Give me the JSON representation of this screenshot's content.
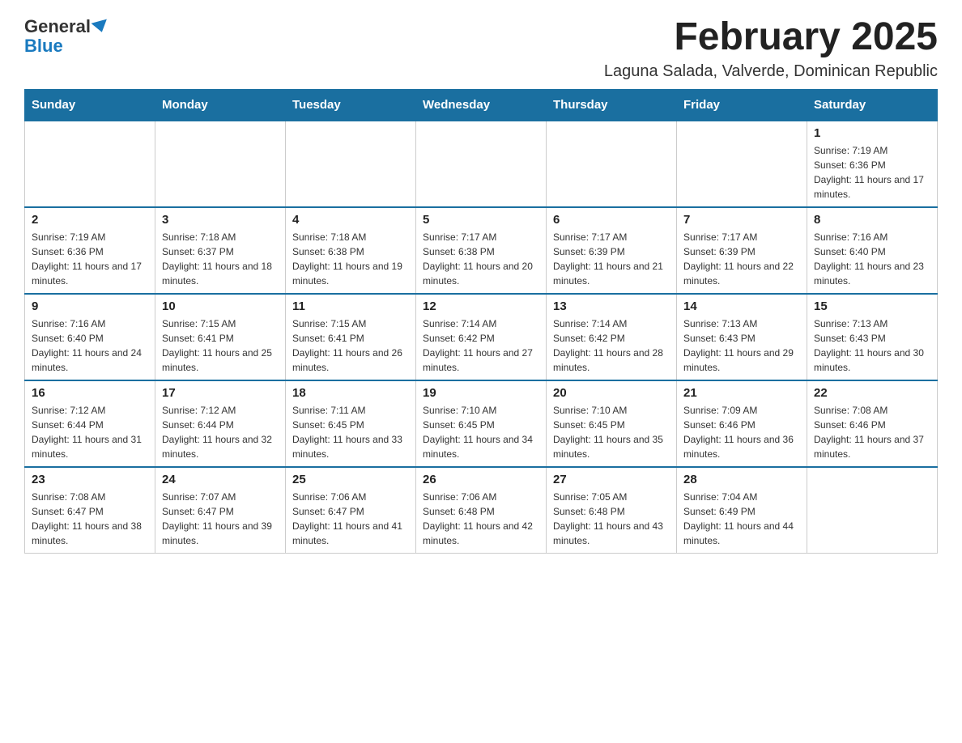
{
  "header": {
    "logo_general": "General",
    "logo_blue": "Blue",
    "title": "February 2025",
    "subtitle": "Laguna Salada, Valverde, Dominican Republic"
  },
  "weekdays": [
    "Sunday",
    "Monday",
    "Tuesday",
    "Wednesday",
    "Thursday",
    "Friday",
    "Saturday"
  ],
  "weeks": [
    [
      {
        "day": "",
        "info": ""
      },
      {
        "day": "",
        "info": ""
      },
      {
        "day": "",
        "info": ""
      },
      {
        "day": "",
        "info": ""
      },
      {
        "day": "",
        "info": ""
      },
      {
        "day": "",
        "info": ""
      },
      {
        "day": "1",
        "info": "Sunrise: 7:19 AM\nSunset: 6:36 PM\nDaylight: 11 hours and 17 minutes."
      }
    ],
    [
      {
        "day": "2",
        "info": "Sunrise: 7:19 AM\nSunset: 6:36 PM\nDaylight: 11 hours and 17 minutes."
      },
      {
        "day": "3",
        "info": "Sunrise: 7:18 AM\nSunset: 6:37 PM\nDaylight: 11 hours and 18 minutes."
      },
      {
        "day": "4",
        "info": "Sunrise: 7:18 AM\nSunset: 6:38 PM\nDaylight: 11 hours and 19 minutes."
      },
      {
        "day": "5",
        "info": "Sunrise: 7:17 AM\nSunset: 6:38 PM\nDaylight: 11 hours and 20 minutes."
      },
      {
        "day": "6",
        "info": "Sunrise: 7:17 AM\nSunset: 6:39 PM\nDaylight: 11 hours and 21 minutes."
      },
      {
        "day": "7",
        "info": "Sunrise: 7:17 AM\nSunset: 6:39 PM\nDaylight: 11 hours and 22 minutes."
      },
      {
        "day": "8",
        "info": "Sunrise: 7:16 AM\nSunset: 6:40 PM\nDaylight: 11 hours and 23 minutes."
      }
    ],
    [
      {
        "day": "9",
        "info": "Sunrise: 7:16 AM\nSunset: 6:40 PM\nDaylight: 11 hours and 24 minutes."
      },
      {
        "day": "10",
        "info": "Sunrise: 7:15 AM\nSunset: 6:41 PM\nDaylight: 11 hours and 25 minutes."
      },
      {
        "day": "11",
        "info": "Sunrise: 7:15 AM\nSunset: 6:41 PM\nDaylight: 11 hours and 26 minutes."
      },
      {
        "day": "12",
        "info": "Sunrise: 7:14 AM\nSunset: 6:42 PM\nDaylight: 11 hours and 27 minutes."
      },
      {
        "day": "13",
        "info": "Sunrise: 7:14 AM\nSunset: 6:42 PM\nDaylight: 11 hours and 28 minutes."
      },
      {
        "day": "14",
        "info": "Sunrise: 7:13 AM\nSunset: 6:43 PM\nDaylight: 11 hours and 29 minutes."
      },
      {
        "day": "15",
        "info": "Sunrise: 7:13 AM\nSunset: 6:43 PM\nDaylight: 11 hours and 30 minutes."
      }
    ],
    [
      {
        "day": "16",
        "info": "Sunrise: 7:12 AM\nSunset: 6:44 PM\nDaylight: 11 hours and 31 minutes."
      },
      {
        "day": "17",
        "info": "Sunrise: 7:12 AM\nSunset: 6:44 PM\nDaylight: 11 hours and 32 minutes."
      },
      {
        "day": "18",
        "info": "Sunrise: 7:11 AM\nSunset: 6:45 PM\nDaylight: 11 hours and 33 minutes."
      },
      {
        "day": "19",
        "info": "Sunrise: 7:10 AM\nSunset: 6:45 PM\nDaylight: 11 hours and 34 minutes."
      },
      {
        "day": "20",
        "info": "Sunrise: 7:10 AM\nSunset: 6:45 PM\nDaylight: 11 hours and 35 minutes."
      },
      {
        "day": "21",
        "info": "Sunrise: 7:09 AM\nSunset: 6:46 PM\nDaylight: 11 hours and 36 minutes."
      },
      {
        "day": "22",
        "info": "Sunrise: 7:08 AM\nSunset: 6:46 PM\nDaylight: 11 hours and 37 minutes."
      }
    ],
    [
      {
        "day": "23",
        "info": "Sunrise: 7:08 AM\nSunset: 6:47 PM\nDaylight: 11 hours and 38 minutes."
      },
      {
        "day": "24",
        "info": "Sunrise: 7:07 AM\nSunset: 6:47 PM\nDaylight: 11 hours and 39 minutes."
      },
      {
        "day": "25",
        "info": "Sunrise: 7:06 AM\nSunset: 6:47 PM\nDaylight: 11 hours and 41 minutes."
      },
      {
        "day": "26",
        "info": "Sunrise: 7:06 AM\nSunset: 6:48 PM\nDaylight: 11 hours and 42 minutes."
      },
      {
        "day": "27",
        "info": "Sunrise: 7:05 AM\nSunset: 6:48 PM\nDaylight: 11 hours and 43 minutes."
      },
      {
        "day": "28",
        "info": "Sunrise: 7:04 AM\nSunset: 6:49 PM\nDaylight: 11 hours and 44 minutes."
      },
      {
        "day": "",
        "info": ""
      }
    ]
  ]
}
